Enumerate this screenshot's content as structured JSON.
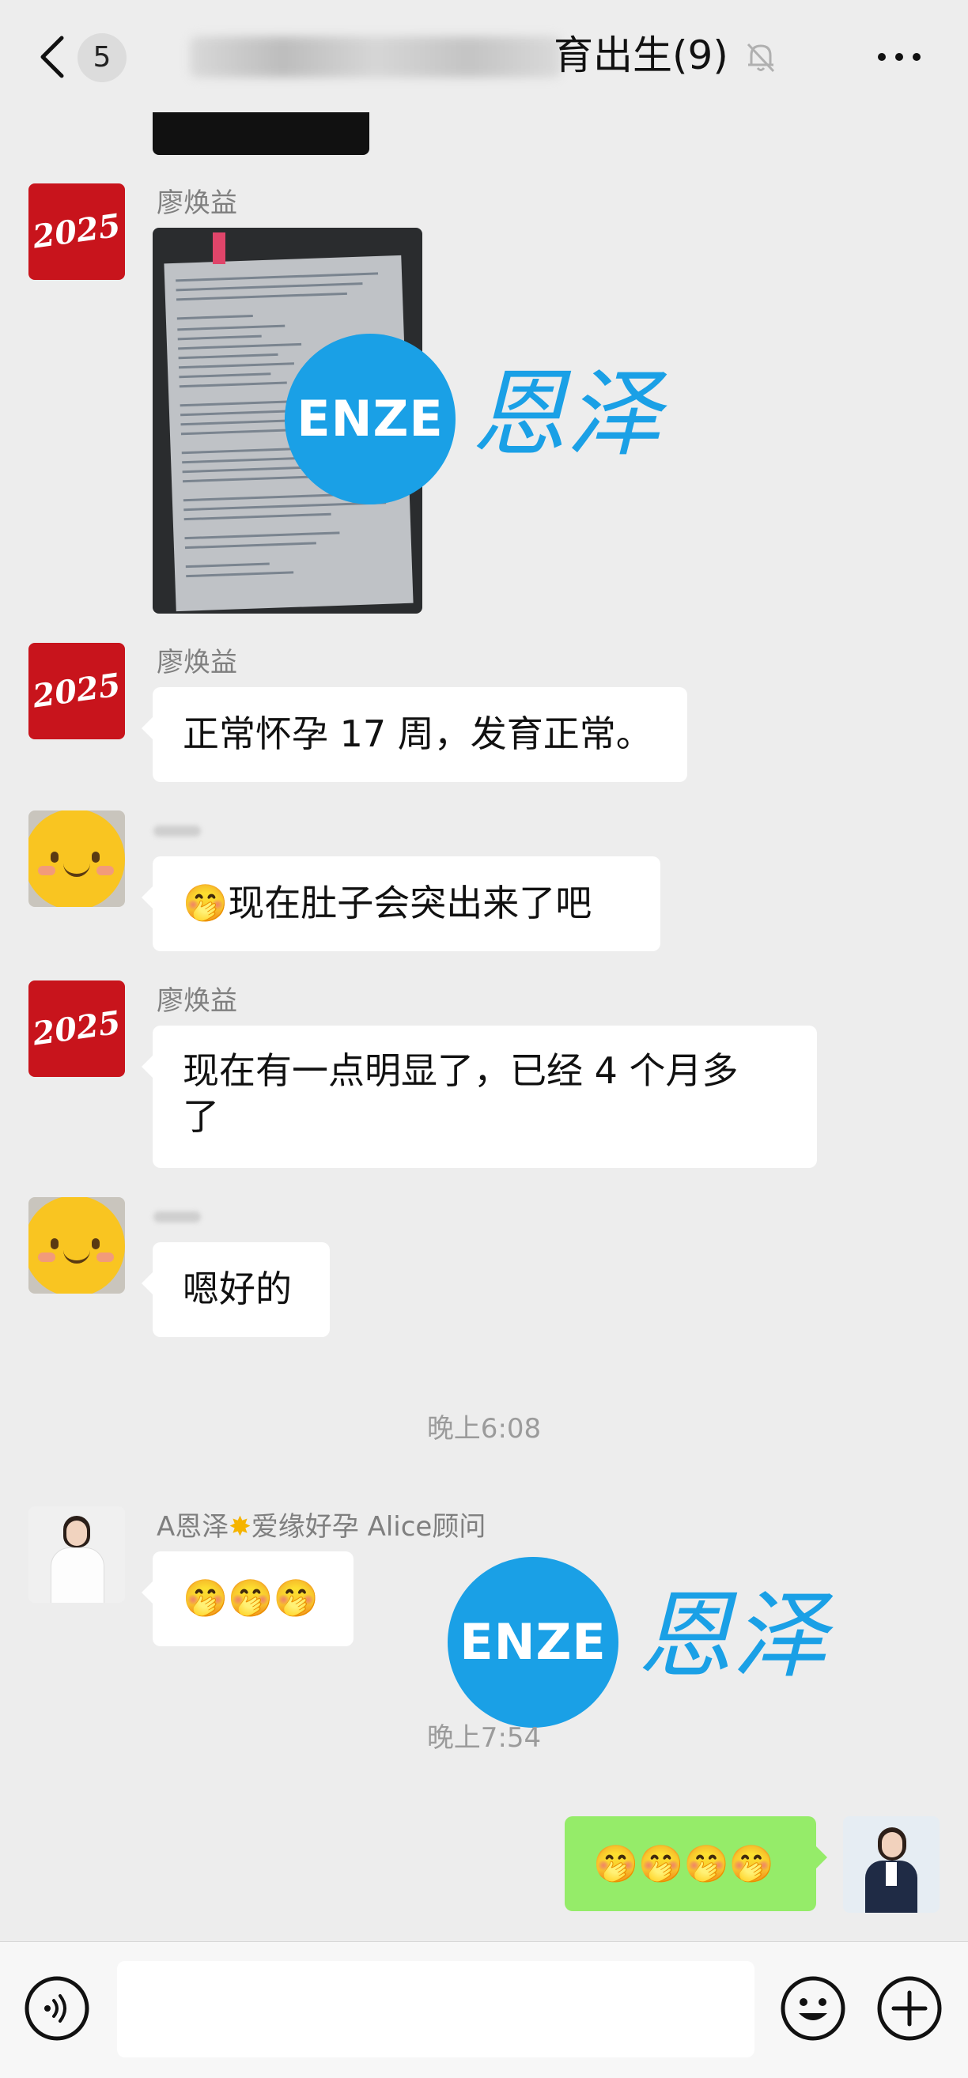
{
  "header": {
    "unread_count": "5",
    "title_visible": "育出生(9)"
  },
  "messages": [
    {
      "sender": "廖焕益",
      "type": "image"
    },
    {
      "sender": "廖焕益",
      "text": "正常怀孕 17 周，发育正常。"
    },
    {
      "sender": "",
      "text": "🤭现在肚子会突出来了吧"
    },
    {
      "sender": "廖焕益",
      "text_line1": "现在有一点明显了，已经 4 个月多",
      "text_line2": "了"
    },
    {
      "sender": "",
      "text": "嗯好的"
    },
    {
      "timestamp": "晚上6:08"
    },
    {
      "sender_part1": "A恩泽",
      "sender_part2": "爱缘好孕 Alice顾问",
      "text": "🤭🤭🤭"
    },
    {
      "timestamp": "晚上7:54"
    },
    {
      "sender": "self",
      "text": "🤭🤭🤭🤭"
    }
  ],
  "avatar_2025_text": "2025",
  "watermark": {
    "logo": "ENZE",
    "name": "恩泽"
  },
  "colors": {
    "chat_bg": "#ededed",
    "bubble": "#ffffff",
    "self_bubble": "#95ec69",
    "watermark": "#1aa0e6"
  }
}
